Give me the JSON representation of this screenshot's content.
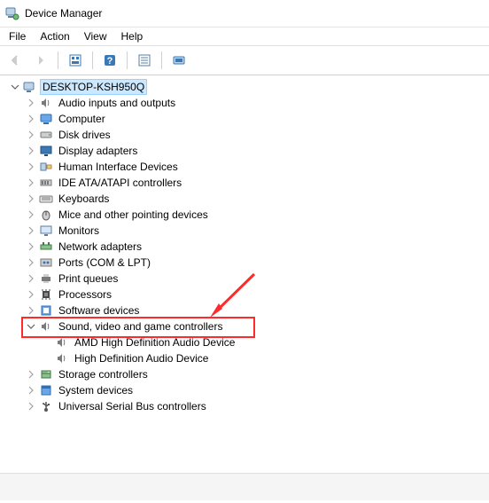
{
  "title": "Device Manager",
  "menu": {
    "items": [
      "File",
      "Action",
      "View",
      "Help"
    ]
  },
  "toolbar": {
    "back": "Back",
    "forward": "Forward",
    "show_hidden": "Show hidden devices",
    "help": "Help",
    "properties": "Properties",
    "scan": "Scan for hardware changes"
  },
  "tree": {
    "root": {
      "label": "DESKTOP-KSH950Q",
      "expanded": true,
      "selected": true
    },
    "categories": [
      {
        "label": "Audio inputs and outputs",
        "icon": "speaker"
      },
      {
        "label": "Computer",
        "icon": "computer"
      },
      {
        "label": "Disk drives",
        "icon": "disk"
      },
      {
        "label": "Display adapters",
        "icon": "display"
      },
      {
        "label": "Human Interface Devices",
        "icon": "hid"
      },
      {
        "label": "IDE ATA/ATAPI controllers",
        "icon": "ide"
      },
      {
        "label": "Keyboards",
        "icon": "keyboard"
      },
      {
        "label": "Mice and other pointing devices",
        "icon": "mouse"
      },
      {
        "label": "Monitors",
        "icon": "monitor"
      },
      {
        "label": "Network adapters",
        "icon": "network"
      },
      {
        "label": "Ports (COM & LPT)",
        "icon": "port"
      },
      {
        "label": "Print queues",
        "icon": "printer"
      },
      {
        "label": "Processors",
        "icon": "cpu"
      },
      {
        "label": "Software devices",
        "icon": "software"
      },
      {
        "label": "Sound, video and game controllers",
        "icon": "speaker",
        "expanded": true,
        "highlighted": true,
        "children": [
          {
            "label": "AMD High Definition Audio Device",
            "icon": "speaker"
          },
          {
            "label": "High Definition Audio Device",
            "icon": "speaker"
          }
        ]
      },
      {
        "label": "Storage controllers",
        "icon": "storage"
      },
      {
        "label": "System devices",
        "icon": "system"
      },
      {
        "label": "Universal Serial Bus controllers",
        "icon": "usb"
      }
    ]
  }
}
